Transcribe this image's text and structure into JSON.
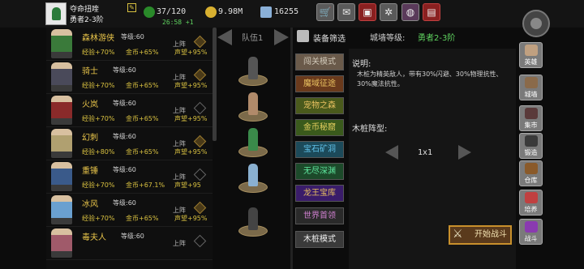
{
  "player": {
    "name": "夺命扭喹",
    "rank": "勇者2-3阶"
  },
  "stats": {
    "stamina": "37/120",
    "gold": "9.98M",
    "gems": "16255",
    "regen": "26:58 +1"
  },
  "toolbar": [
    {
      "icon": "cart-icon",
      "glyph": "🛒"
    },
    {
      "icon": "mail-icon",
      "glyph": "✉"
    },
    {
      "icon": "chest-icon",
      "glyph": "▣"
    },
    {
      "icon": "gear-icon",
      "glyph": "✲"
    },
    {
      "icon": "wheel-icon",
      "glyph": "◍"
    },
    {
      "icon": "clipboard-icon",
      "glyph": "▤"
    }
  ],
  "heroes": [
    {
      "name": "森林游侠",
      "level": "等级:60",
      "up": "上阵",
      "exp": "经验+70%",
      "gold": "金币+65%",
      "fame": "声望+95%",
      "color": "#3a7a3a",
      "deployed": true
    },
    {
      "name": "骑士",
      "level": "等级:60",
      "up": "上阵",
      "exp": "经验+70%",
      "gold": "金币+65%",
      "fame": "声望+95%",
      "color": "#4a4a5a",
      "deployed": true
    },
    {
      "name": "火岚",
      "level": "等级:60",
      "up": "上阵",
      "exp": "经验+70%",
      "gold": "金币+65%",
      "fame": "声望+95%",
      "color": "#8a2a2a",
      "deployed": false
    },
    {
      "name": "幻刺",
      "level": "等级:60",
      "up": "上阵",
      "exp": "经验+80%",
      "gold": "金币+65%",
      "fame": "声望+95%",
      "color": "#b0a070",
      "deployed": true
    },
    {
      "name": "重锤",
      "level": "等级:60",
      "up": "上阵",
      "exp": "经验+70%",
      "gold": "金币+67.1%",
      "fame": "声望+95",
      "color": "#3a5a8a",
      "deployed": false
    },
    {
      "name": "冰风",
      "level": "等级:60",
      "up": "上阵",
      "exp": "经验+70%",
      "gold": "金币+65%",
      "fame": "声望+95%",
      "color": "#6aa0d0",
      "deployed": true
    },
    {
      "name": "毒夫人",
      "level": "等级:60",
      "up": "上阵",
      "exp": "",
      "gold": "",
      "fame": "",
      "color": "#a05a6a",
      "deployed": false
    }
  ],
  "team": {
    "label": "队伍1",
    "members": [
      "#555",
      "#b08a6a",
      "#3a8a4a",
      "#8ab0d0",
      "#444"
    ]
  },
  "filter_label": "装备筛选",
  "modes": [
    {
      "label": "闯关模式",
      "bg": "#6a5a4a",
      "fg": "#d0c8b8"
    },
    {
      "label": "魔域征途",
      "bg": "#6a3a1c",
      "fg": "#e8c060"
    },
    {
      "label": "宠物之森",
      "bg": "#4a5a1c",
      "fg": "#e8c060"
    },
    {
      "label": "金币秘窟",
      "bg": "#3a5a1c",
      "fg": "#e8d060"
    },
    {
      "label": "宝石矿洞",
      "bg": "#1c4a5a",
      "fg": "#60c0e8"
    },
    {
      "label": "无尽深渊",
      "bg": "#1c4a2a",
      "fg": "#60e8a0"
    },
    {
      "label": "龙王宝库",
      "bg": "#3a1c6a",
      "fg": "#e8c060"
    },
    {
      "label": "世界首领",
      "bg": "#2a2a2a",
      "fg": "#d080d0"
    },
    {
      "label": "木桩模式",
      "bg": "#3a3a3a",
      "fg": "#f0f0f0"
    }
  ],
  "wall": {
    "label": "城墙等级:",
    "rank": "勇者2-3阶"
  },
  "description": {
    "title": "说明:",
    "body": "木桩为精英敌人，带有30%闪避、30%物理抗性、30%魔法抗性。"
  },
  "formation": {
    "title": "木桩阵型:",
    "value": "1x1"
  },
  "start_button": "开始战斗",
  "nav": [
    {
      "label": "英雄",
      "color": "#c0a080"
    },
    {
      "label": "城墙",
      "color": "#8a6a4a"
    },
    {
      "label": "集市",
      "color": "#5a3a3a"
    },
    {
      "label": "锻造",
      "color": "#3a3a3a"
    },
    {
      "label": "仓库",
      "color": "#8a5a2a"
    },
    {
      "label": "培养",
      "color": "#c04040"
    },
    {
      "label": "战斗",
      "color": "#8a3ab0"
    }
  ]
}
